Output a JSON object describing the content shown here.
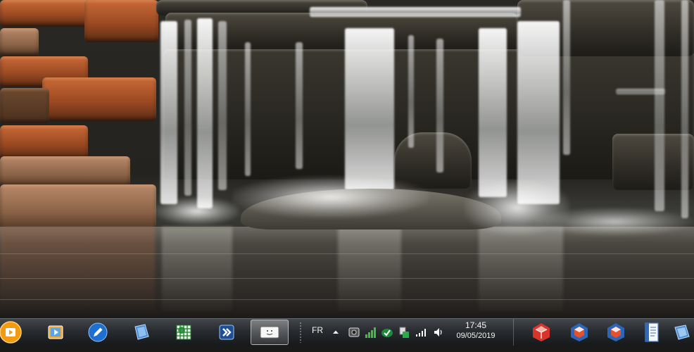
{
  "desktop": {
    "wallpaper": "waterfall-photo"
  },
  "taskbar": {
    "start_icon": "media-player-start-icon",
    "pinned": [
      {
        "name": "video-library-icon",
        "active": false
      },
      {
        "name": "pen-app-icon",
        "active": false
      },
      {
        "name": "notebook-icon",
        "active": false
      },
      {
        "name": "spreadsheet-grid-icon",
        "active": false
      },
      {
        "name": "double-chevron-app-icon",
        "active": false
      },
      {
        "name": "on-screen-keyboard-icon",
        "active": true
      }
    ],
    "tray": {
      "language": "FR",
      "icons": [
        "show-hidden-icons-chevron",
        "camera-app-icon",
        "signal-bars-green-icon",
        "checkmark-shield-icon",
        "usb-device-icon",
        "network-signal-icon",
        "volume-icon"
      ],
      "time": "17:45",
      "date": "09/05/2019"
    },
    "right_apps": [
      {
        "name": "sketchup-icon"
      },
      {
        "name": "3d-cube-app-icon"
      },
      {
        "name": "3d-cube-app-icon-2"
      },
      {
        "name": "document-list-icon"
      },
      {
        "name": "blue-notebook-icon"
      }
    ]
  }
}
